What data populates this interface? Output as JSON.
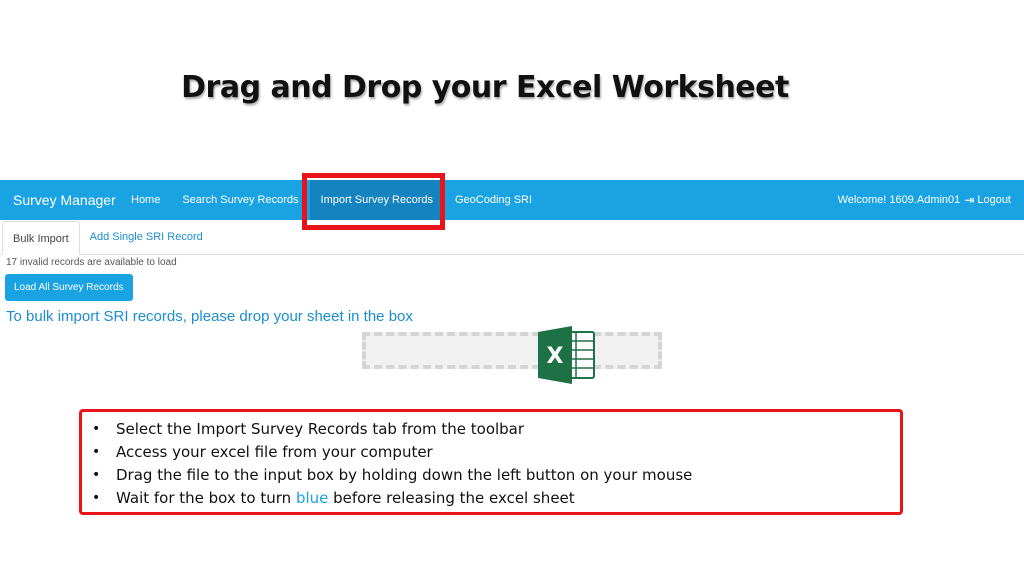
{
  "slide": {
    "title": "Drag and Drop your Excel Worksheet"
  },
  "navbar": {
    "brand": "Survey Manager",
    "items": [
      {
        "label": "Home"
      },
      {
        "label": "Search Survey Records"
      },
      {
        "label": "Import Survey Records",
        "active": true
      },
      {
        "label": "GeoCoding SRI"
      }
    ],
    "welcome": "Welcome! 1609.Admin01",
    "logout": "Logout"
  },
  "subtabs": [
    {
      "label": "Bulk Import",
      "active": true
    },
    {
      "label": "Add Single SRI Record"
    }
  ],
  "records_note": "17 invalid records are available to load",
  "load_button": "Load All Survey Records",
  "instruction": "To bulk import SRI records, please drop your sheet in the box",
  "excel_icon": {
    "letter": "X",
    "color": "#1e7145"
  },
  "steps": {
    "bullet": "•",
    "items": [
      "Select the Import Survey Records tab from the toolbar",
      "Access your excel file from your computer",
      "Drag the file to the input box by holding down the left button on your mouse"
    ],
    "last": {
      "before": "Wait for the box to turn ",
      "highlight": "blue",
      "after": " before releasing the excel sheet"
    }
  },
  "colors": {
    "accent": "#1aa3e2",
    "highlight": "#e8141a"
  }
}
